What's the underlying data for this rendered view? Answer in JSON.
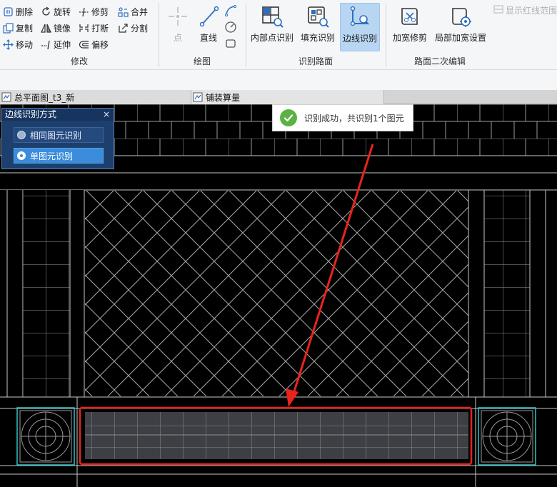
{
  "ribbon": {
    "modify": {
      "label": "修改",
      "buttons": {
        "delete": "删除",
        "rotate": "旋转",
        "trim": "修剪",
        "merge": "合并",
        "copy": "复制",
        "mirror": "镜像",
        "break": "打断",
        "split": "分割",
        "move": "移动",
        "extend": "延伸",
        "offset": "偏移"
      }
    },
    "draw": {
      "label": "绘图",
      "point": "点",
      "line": "直线"
    },
    "recognize": {
      "label": "识别路面",
      "inner_point": "内部点识别",
      "fill": "填充识别",
      "edge": "边线识别"
    },
    "edit2": {
      "label": "路面二次编辑",
      "widen_trim": "加宽修剪",
      "local_widen": "局部加宽设置"
    },
    "show_redline": "显示红线范围"
  },
  "tabs": [
    "总平面图_t3_新",
    "铺装算量"
  ],
  "panel": {
    "title": "边线识别方式",
    "close": "×",
    "options": [
      "相同图元识别",
      "单图元识别"
    ],
    "selected": 1
  },
  "toast": {
    "message": "识别成功，共识别1个图元"
  },
  "colors": {
    "accent": "#3b8ddb",
    "highlight": "#e8241c",
    "active_button": "#b8d6f2",
    "success": "#59b243"
  }
}
